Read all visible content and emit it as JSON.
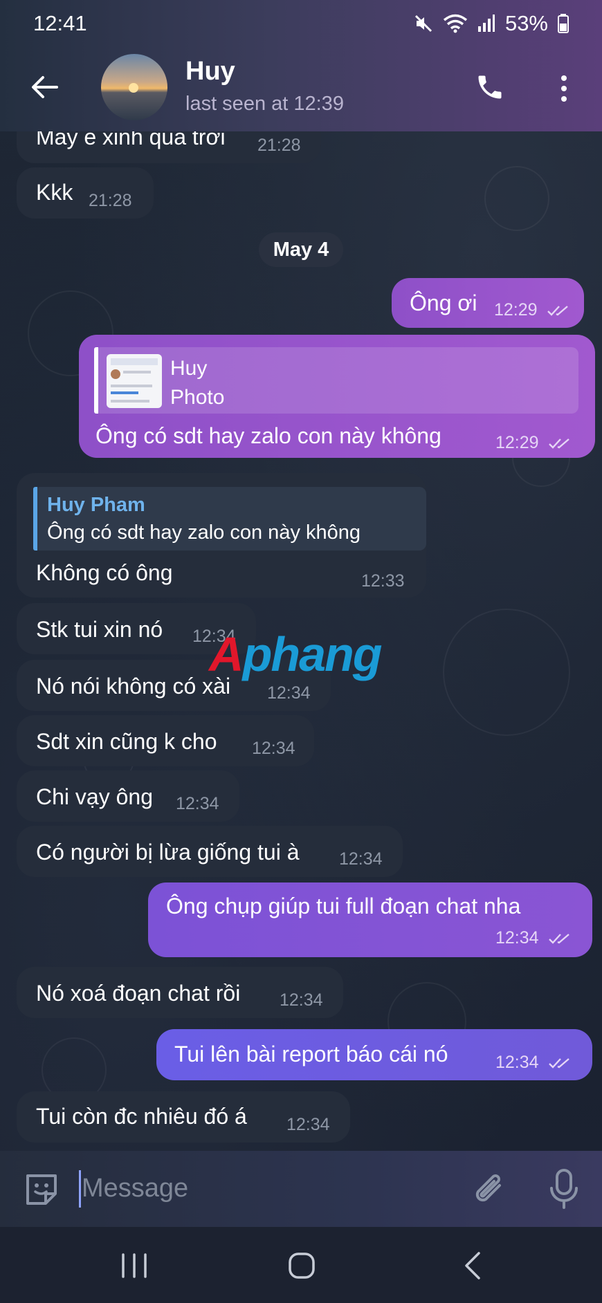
{
  "status_bar": {
    "time": "12:41",
    "battery": "53%"
  },
  "header": {
    "name": "Huy",
    "last_seen": "last seen at 12:39"
  },
  "messages": [
    {
      "text": "Mày e xinh quá trời",
      "time": "21:28"
    },
    {
      "text": "Kkk",
      "time": "21:28"
    },
    {
      "date": "May 4"
    },
    {
      "text": "Ông ơi",
      "time": "12:29"
    },
    {
      "reply_name": "Huy",
      "reply_text": "Photo",
      "text": "Ông có sdt hay zalo con này không",
      "time": "12:29"
    },
    {
      "reply_name": "Huy Pham",
      "reply_text": "Ông có sdt hay zalo con này không",
      "text": "Không có ông",
      "time": "12:33"
    },
    {
      "text": "Stk tui xin nó",
      "time": "12:34"
    },
    {
      "text": "Nó nói không có xài",
      "time": "12:34"
    },
    {
      "text": "Sdt xin cũng k cho",
      "time": "12:34"
    },
    {
      "text": "Chi vạy ông",
      "time": "12:34"
    },
    {
      "text": "Có người bị lừa giống tui à",
      "time": "12:34"
    },
    {
      "text": "Ông chụp giúp tui full đoạn chat nha",
      "time": "12:34"
    },
    {
      "text": "Nó xoá đoạn chat rồi",
      "time": "12:34"
    },
    {
      "text": "Tui lên bài report báo cái nó",
      "time": "12:34"
    },
    {
      "text": "Tui còn đc nhiêu đó á",
      "time": "12:34"
    }
  ],
  "watermark": {
    "first": "A",
    "rest": "phang"
  },
  "composer": {
    "placeholder": "Message"
  },
  "icons": [
    "back-arrow-icon",
    "phone-icon",
    "more-vert-icon",
    "sticker-icon",
    "paperclip-icon",
    "mic-icon",
    "recent-apps-icon",
    "home-icon",
    "nav-back-icon"
  ]
}
